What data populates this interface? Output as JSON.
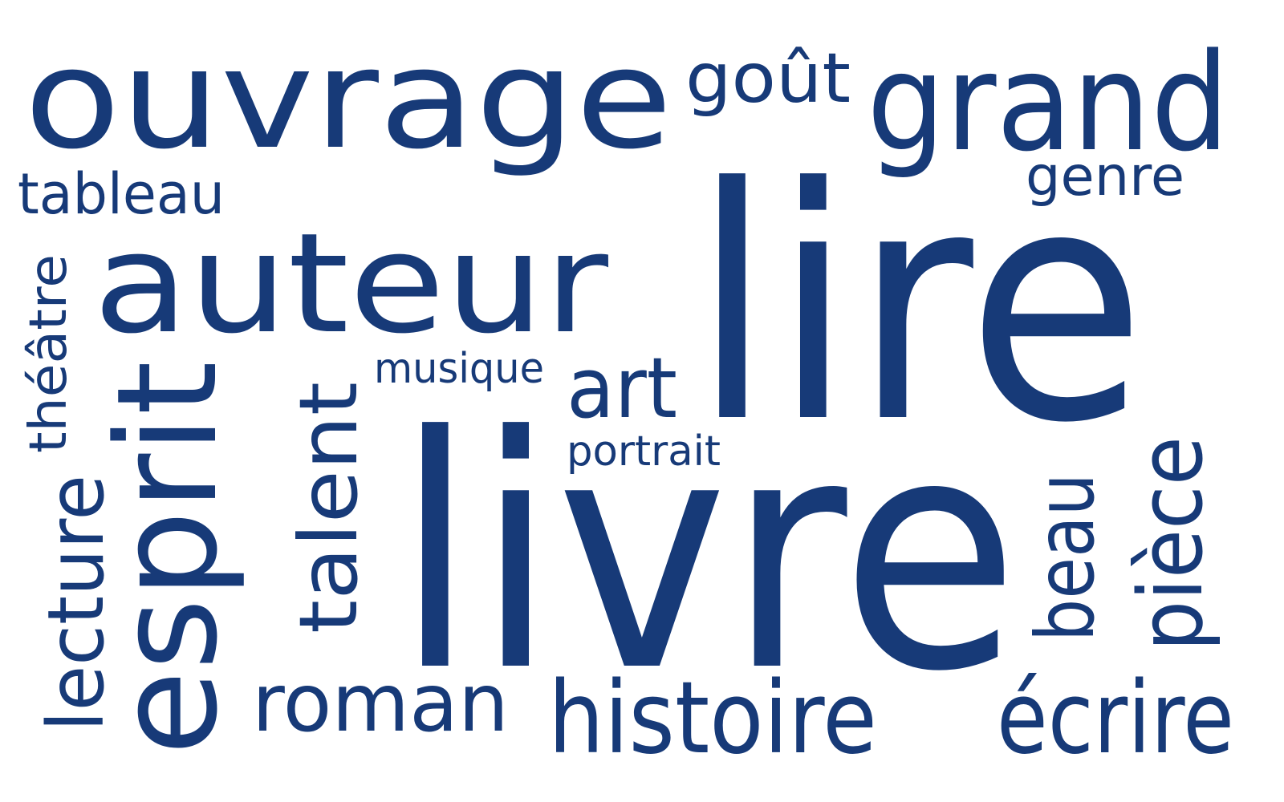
{
  "color": "#173a78",
  "words": {
    "ouvrage": "ouvrage",
    "gout": "goût",
    "grand": "grand",
    "tableau": "tableau",
    "genre": "genre",
    "auteur": "auteur",
    "lire": "lire",
    "theatre": "théâtre",
    "musique": "musique",
    "art": "art",
    "esprit": "esprit",
    "talent": "talent",
    "portrait": "portrait",
    "livre": "livre",
    "lecture": "lecture",
    "beau": "beau",
    "piece": "pièce",
    "roman": "roman",
    "histoire": "histoire",
    "ecrire": "écrire"
  }
}
